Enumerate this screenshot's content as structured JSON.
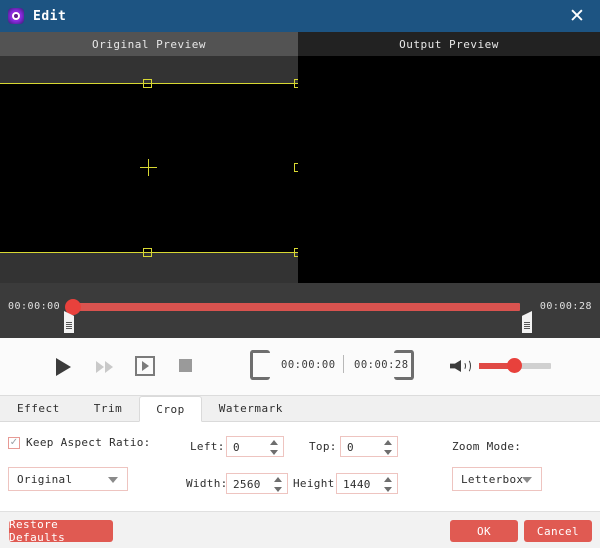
{
  "window": {
    "title": "Edit",
    "icon": "app-target-icon",
    "close_label": "✕",
    "titlebar_color": "#1d5482"
  },
  "preview": {
    "original_label": "Original Preview",
    "output_label": "Output Preview",
    "crop_overlay_color": "#d8d832"
  },
  "timeline": {
    "start_time": "00:00:00",
    "end_time": "00:00:28",
    "track_color": "#d9534f",
    "knob_color": "#e8413c",
    "playhead_percent": 0,
    "trim_start_percent": 0,
    "trim_end_percent": 100
  },
  "controls": {
    "play_label": "play-icon",
    "fast_forward_label": "fast-forward-icon",
    "frame_step_label": "frame-step-icon",
    "stop_label": "stop-icon",
    "mark_in_label": "mark-in-icon",
    "mark_out_label": "mark-out-icon",
    "current_time": "00:00:00",
    "total_time": "00:00:28",
    "volume_label": "volume-icon",
    "volume_percent": 50
  },
  "tabs": [
    {
      "label": "Effect",
      "active": false
    },
    {
      "label": "Trim",
      "active": false
    },
    {
      "label": "Crop",
      "active": true
    },
    {
      "label": "Watermark",
      "active": false
    }
  ],
  "crop_panel": {
    "keep_aspect_ratio_label": "Keep Aspect Ratio:",
    "keep_aspect_ratio_checked": true,
    "preset_value": "Original",
    "left_label": "Left:",
    "left_value": "0",
    "top_label": "Top:",
    "top_value": "0",
    "width_label": "Width:",
    "width_value": "2560",
    "height_label": "Height:",
    "height_value": "1440",
    "zoom_mode_label": "Zoom Mode:",
    "zoom_mode_value": "Letterbox"
  },
  "footer": {
    "restore_defaults_label": "Restore Defaults",
    "ok_label": "OK",
    "cancel_label": "Cancel",
    "button_color": "#e05a52"
  }
}
